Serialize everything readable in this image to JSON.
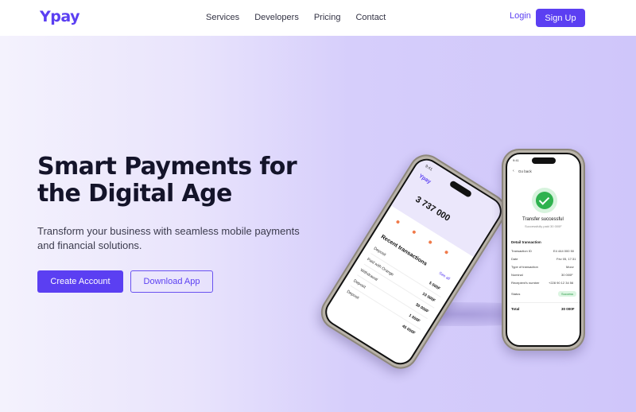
{
  "brand": {
    "logo": "Ypay",
    "accent": "#5b3ff2"
  },
  "nav": {
    "links": [
      "Services",
      "Developers",
      "Pricing",
      "Contact"
    ],
    "login": "Login",
    "signup": "Sign Up"
  },
  "hero": {
    "title": "Smart Payments for the Digital Age",
    "subtitle": "Transform your business with seamless mobile payments and financial solutions.",
    "primary_cta": "Create Account",
    "secondary_cta": "Download App"
  },
  "phone_left": {
    "time": "9:41",
    "app": "Ypay",
    "balance": "3 737 000",
    "section_title": "Recent transactions",
    "see_all": "See all",
    "transactions": [
      {
        "label": "Deposit",
        "amount": "5 000F"
      },
      {
        "label": "Paid with Orange",
        "amount": "10 000F"
      },
      {
        "label": "Withdrawal",
        "amount": "30 000F"
      },
      {
        "label": "Deposit",
        "amount": "1 000F"
      },
      {
        "label": "Deposit",
        "amount": "45 000F"
      }
    ]
  },
  "phone_right": {
    "time": "9:41",
    "back": "Go back",
    "status_title": "Transfer successful",
    "status_sub": "Successfully paid 30 000F",
    "detail_header": "Detail transaction",
    "details": [
      {
        "label": "Transaction ID",
        "value": "E4 444 000 50"
      },
      {
        "label": "Date",
        "value": "Fev 05, 17:31"
      },
      {
        "label": "Type of transaction",
        "value": "Moov"
      },
      {
        "label": "Nominal",
        "value": "30 000F"
      },
      {
        "label": "Recepient's number",
        "value": "+228 90 12 34 56"
      }
    ],
    "status_label": "Status",
    "status_value": "Success",
    "total_label": "Total",
    "total_value": "30 000F"
  }
}
